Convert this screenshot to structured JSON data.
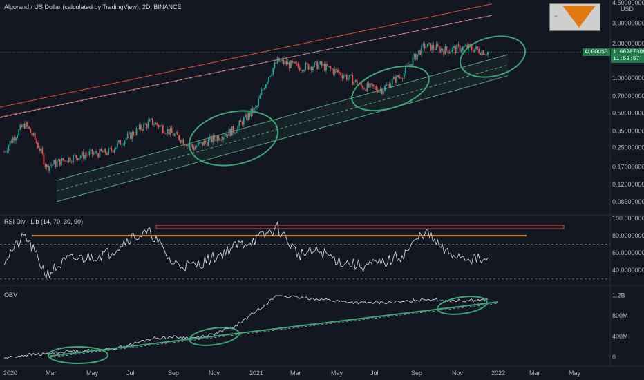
{
  "header": {
    "title": "Algorand / US Dollar (calculated by TradingView), 2D, BINANCE"
  },
  "price_scale": {
    "currency": "USD",
    "ticks": [
      "4.50000000",
      "3.00000000",
      "2.00000000",
      "1.50000000",
      "1.00000000",
      "0.70000000",
      "0.50000000",
      "0.35000000",
      "0.25000000",
      "0.17000000",
      "0.12000000",
      "0.08500000"
    ]
  },
  "current_price": {
    "symbol": "ALGOUSD",
    "value": "1.68287309",
    "countdown": "11:52:57"
  },
  "rsi_panel": {
    "title": "RSI Div - Lib (14, 70, 30, 90)",
    "ticks": [
      "100.00000000",
      "80.00000000",
      "60.00000000",
      "40.00000000"
    ]
  },
  "obv_panel": {
    "title": "OBV",
    "ticks": [
      "1.2B",
      "800M",
      "400M",
      "0"
    ]
  },
  "time_axis": [
    "2020",
    "Mar",
    "May",
    "Jul",
    "Sep",
    "Nov",
    "2021",
    "Mar",
    "May",
    "Jul",
    "Sep",
    "Nov",
    "2022",
    "Mar",
    "May"
  ],
  "colors": {
    "background": "#131722",
    "up": "#26a69a",
    "down": "#ef5350",
    "channel_red": "#e04a3f",
    "channel_green": "#5aa57a",
    "highlight_ellipse": "#3fa577",
    "rsi_line": "#d1d4dc",
    "rsi_box": "#e04a3f",
    "rsi_level": "#e08a2e",
    "obv_line": "#d1d4dc",
    "price_badge": "#1e7a4a"
  },
  "chart_data": [
    {
      "type": "candlestick",
      "title": "Algorand / US Dollar (calculated by TradingView), 2D, BINANCE",
      "scale": "log",
      "ylim": [
        0.07,
        4.5
      ],
      "x": [
        "2020-01",
        "2020-02",
        "2020-03",
        "2020-04",
        "2020-05",
        "2020-06",
        "2020-07",
        "2020-08",
        "2020-09",
        "2020-10",
        "2020-11",
        "2020-12",
        "2021-01",
        "2021-02",
        "2021-03",
        "2021-04",
        "2021-05",
        "2021-06",
        "2021-07",
        "2021-08",
        "2021-09",
        "2021-10",
        "2021-11",
        "2021-12"
      ],
      "close": [
        0.23,
        0.4,
        0.17,
        0.2,
        0.22,
        0.23,
        0.32,
        0.42,
        0.33,
        0.25,
        0.3,
        0.36,
        0.55,
        1.4,
        1.25,
        1.3,
        1.1,
        0.85,
        0.8,
        1.1,
        1.9,
        1.75,
        1.85,
        1.68
      ]
    },
    {
      "type": "line",
      "title": "RSI Div - Lib (14, 70, 30, 90)",
      "ylim": [
        25,
        100
      ],
      "levels": [
        70,
        30
      ],
      "x": [
        "2020-01",
        "2020-02",
        "2020-03",
        "2020-04",
        "2020-05",
        "2020-06",
        "2020-07",
        "2020-08",
        "2020-09",
        "2020-10",
        "2020-11",
        "2020-12",
        "2021-01",
        "2021-02",
        "2021-03",
        "2021-04",
        "2021-05",
        "2021-06",
        "2021-07",
        "2021-08",
        "2021-09",
        "2021-10",
        "2021-11",
        "2021-12"
      ],
      "values": [
        52,
        80,
        35,
        52,
        55,
        60,
        78,
        83,
        48,
        45,
        55,
        68,
        76,
        89,
        58,
        62,
        50,
        45,
        48,
        58,
        85,
        60,
        55,
        50
      ]
    },
    {
      "type": "line",
      "title": "OBV",
      "ylim": [
        -150000000,
        1300000000
      ],
      "x": [
        "2020-01",
        "2020-02",
        "2020-03",
        "2020-04",
        "2020-05",
        "2020-06",
        "2020-07",
        "2020-08",
        "2020-09",
        "2020-10",
        "2020-11",
        "2020-12",
        "2021-01",
        "2021-02",
        "2021-03",
        "2021-04",
        "2021-05",
        "2021-06",
        "2021-07",
        "2021-08",
        "2021-09",
        "2021-10",
        "2021-11",
        "2021-12"
      ],
      "values": [
        -20000000,
        40000000,
        60000000,
        110000000,
        130000000,
        150000000,
        240000000,
        360000000,
        390000000,
        370000000,
        450000000,
        600000000,
        900000000,
        1200000000,
        1150000000,
        1130000000,
        1080000000,
        1050000000,
        1060000000,
        1070000000,
        1130000000,
        1100000000,
        1100000000,
        1110000000
      ]
    }
  ]
}
